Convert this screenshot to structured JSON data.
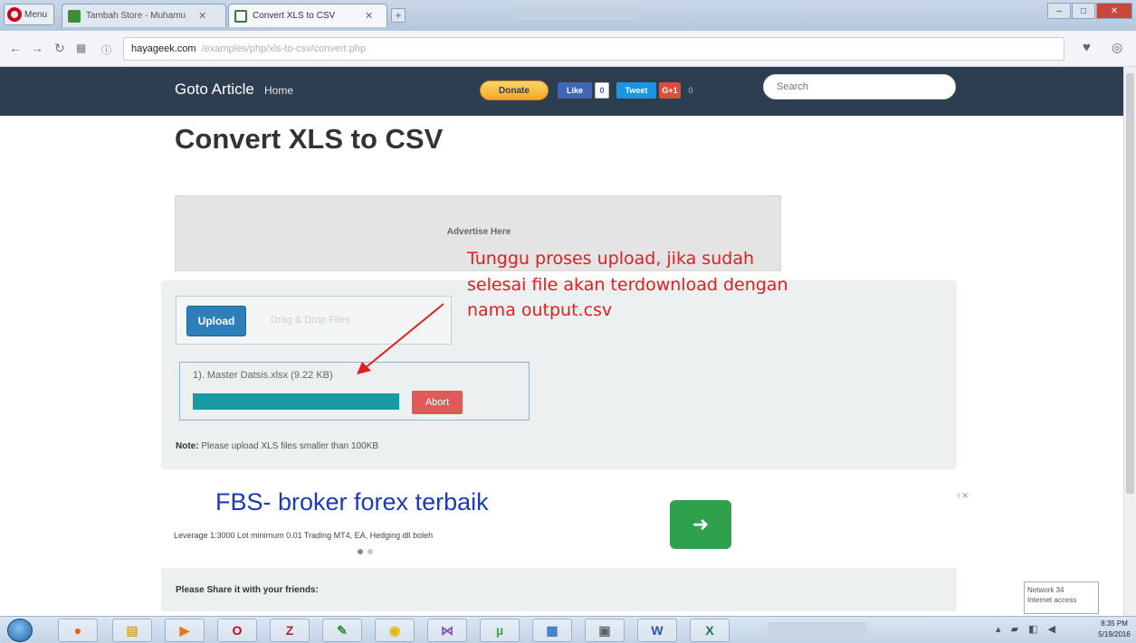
{
  "browser": {
    "menu_label": "Menu",
    "tabs": [
      {
        "label": "Tambah Store - Muhamu",
        "active": false
      },
      {
        "label": "Convert XLS to CSV",
        "active": true
      }
    ],
    "url_domain": "hayageek.com",
    "url_path": "/examples/php/xls-to-csv/convert.php"
  },
  "site": {
    "brand": "Goto Article",
    "nav_home": "Home",
    "donate_label": "Donate",
    "fb_like_label": "Like",
    "fb_like_count": "0",
    "tweet_label": "Tweet",
    "gplus_label": "G+1",
    "gplus_count": "0",
    "search_placeholder": "Search"
  },
  "page": {
    "title": "Convert XLS to CSV",
    "ad_label": "Advertise Here",
    "upload_button": "Upload",
    "drop_hint": "Drag & Drop Files",
    "file_info": "1). Master Datsis.xlsx (9.22 KB)",
    "upload_progress": 1.0,
    "abort_button": "Abort",
    "note_label": "Note:",
    "note_text": " Please upload XLS files smaller than 100KB",
    "share_text": "Please Share it with your friends:"
  },
  "annotation": {
    "lines": [
      "Tunggu proses upload, jika sudah",
      "selesai file akan terdownload dengan",
      "nama output.csv"
    ],
    "color": "#e02020"
  },
  "ad2": {
    "headline": "FBS- broker forex terbaik",
    "subline": "Leverage 1:3000 Lot minimum 0.01 Trading MT4, EA, Hedging dll boleh",
    "button_icon": "arrow-right-icon",
    "choice_label": "i ✕"
  },
  "tooltip": {
    "line1": "Network 34",
    "line2": "Internet access"
  },
  "taskbar": {
    "apps": [
      "firefox-icon",
      "explorer-icon",
      "media-icon",
      "opera-icon",
      "filezilla-icon",
      "paint-icon",
      "chrome-icon",
      "app-icon",
      "utorrent-icon",
      "network-icon",
      "calculator-icon",
      "word-icon",
      "excel-icon"
    ],
    "clock_time": "8:35 PM",
    "clock_date": "5/19/2016"
  },
  "colors": {
    "navbar": "#2d3e50",
    "upload_button": "#2c7fb8",
    "progress_fill": "#1a9aa3",
    "abort": "#e05a5a",
    "ad_headline": "#1a3bb8",
    "ad_button": "#2fa14c"
  }
}
